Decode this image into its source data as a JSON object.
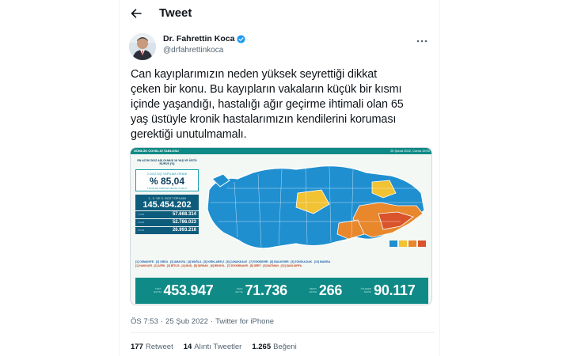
{
  "header": {
    "title": "Tweet",
    "back_icon": "arrow-left-icon"
  },
  "author": {
    "name": "Dr. Fahrettin Koca",
    "handle": "@drfahrettinkoca",
    "verified": true,
    "verified_color": "#1d9bf0"
  },
  "tweet": {
    "line1": "Can kayıplarımızın neden yüksek seyrettiği dikkat",
    "line2": "çeken bir konu. Bu kayıpların vakaların küçük bir kısmı",
    "line3": "içinde yaşandığı, hastalığı ağır geçirme ihtimali olan 65",
    "line4": "yaş üstüyle kronik hastalarımızın kendilerini koruması",
    "line5": "gerektiği unutulmamalı."
  },
  "media": {
    "top_left": "GÜNLÜK COVID-19 TABLOSU",
    "top_right": "25 Şubat 2022, Cuma 19:00",
    "left_heading": "EN AZ İKİ DOZ AŞI OLMUŞ 18 YAŞ VE ÜSTÜ NÜFUS (%)",
    "dose2_label": "2.DOZ AŞI YAPILMA ORANI",
    "dose2_value": "% 85,04",
    "dose2_note": "1.DOZ AŞI YAPILMA ORANI: % 92,07",
    "total_label": "1., 2. VE 3. DOZ TOPLAMI",
    "total_value": "145.454.202",
    "doses": [
      {
        "label": "1.DOZ",
        "value": "57.668.314"
      },
      {
        "label": "2.DOZ",
        "value": "52.786.023"
      },
      {
        "label": "3.DOZ",
        "value": "26.993.216"
      }
    ],
    "provinces_line1": "[1] OSMANİYE . [2] ORDU . [3] AMASYA . [4] MUĞLA . [5] KIRKLARELİ . [6] ÇANAKKALE . [7] ESKİŞEHİR . [8] BALIKESİR . [9] ZONGULDAK . [10] MANİSA",
    "provinces_line2": "[1] HAKKARİ . [2] AĞRI . [3] BİTLİS . [4] MUŞ . [5] ŞIRNAK . [6] BİNGÖL . [7] DİYARBAKIR . [8] SİİRT . [9] BATMAN . [10] ŞANLIURFA",
    "stats": [
      {
        "label": "TEST SAYISI",
        "value": "453.947"
      },
      {
        "label": "VAKA SAYISI",
        "value": "71.736"
      },
      {
        "label": "VEFAT SAYISI",
        "value": "266"
      },
      {
        "label": "İYİLEŞEN SAYISI",
        "value": "90.117"
      }
    ],
    "colors": {
      "teal": "#0f8a86",
      "blue": "#1f8fd0",
      "yellow": "#f1c232",
      "orange": "#e8872c",
      "red": "#d9532b"
    }
  },
  "meta": {
    "time": "ÖS 7:53",
    "sep1": "·",
    "date": "25 Şub 2022",
    "sep2": "·",
    "source": "Twitter for iPhone"
  },
  "stats": {
    "retweets": {
      "count": "177",
      "label": "Retweet"
    },
    "quotes": {
      "count": "14",
      "label": "Alıntı Tweetler"
    },
    "likes": {
      "count": "1.265",
      "label": "Beğeni"
    }
  }
}
